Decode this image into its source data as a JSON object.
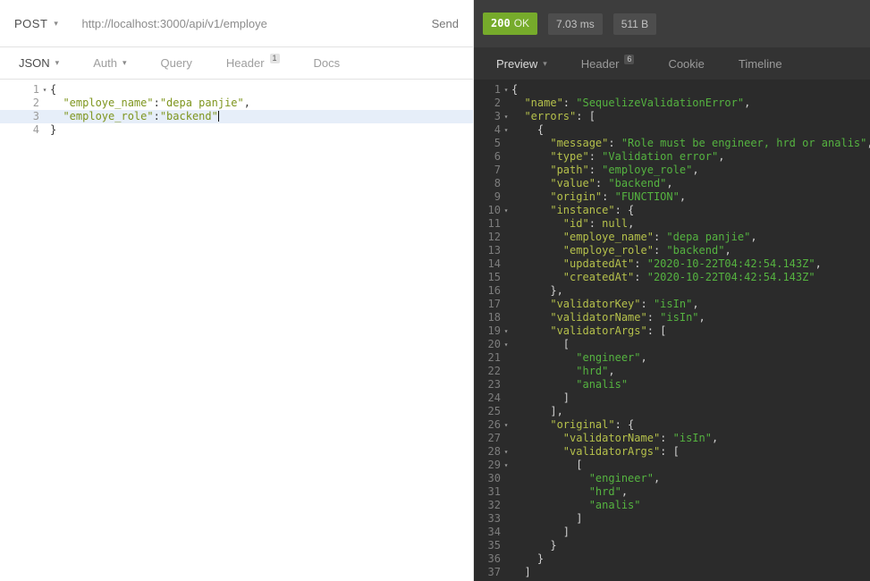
{
  "icons": {
    "chevron_down": "▾",
    "fold": "▾"
  },
  "request_bar": {
    "method": "POST",
    "url": "http://localhost:3000/api/v1/employe",
    "send_label": "Send"
  },
  "response_meta": {
    "status_code": "200",
    "status_text": "OK",
    "time": "7.03 ms",
    "size": "511 B"
  },
  "request_tabs": [
    {
      "label": "JSON",
      "active": true,
      "dropdown": true
    },
    {
      "label": "Auth",
      "dropdown": true
    },
    {
      "label": "Query"
    },
    {
      "label": "Header",
      "badge": "1"
    },
    {
      "label": "Docs"
    }
  ],
  "response_tabs": [
    {
      "label": "Preview",
      "active": true,
      "dropdown": true
    },
    {
      "label": "Header",
      "badge": "6"
    },
    {
      "label": "Cookie"
    },
    {
      "label": "Timeline"
    }
  ],
  "request_editor": {
    "lines": [
      {
        "n": 1,
        "f": true,
        "t": [
          [
            "p",
            "{"
          ]
        ]
      },
      {
        "n": 2,
        "f": false,
        "t": [
          [
            "k",
            "  \"employe_name\""
          ],
          [
            "p",
            ":"
          ],
          [
            "s",
            "\"depa panjie\""
          ],
          [
            "p",
            ","
          ]
        ]
      },
      {
        "n": 3,
        "f": false,
        "a": true,
        "t": [
          [
            "k",
            "  \"employe_role\""
          ],
          [
            "p",
            ":"
          ],
          [
            "s",
            "\"backend\""
          ],
          [
            "cur",
            ""
          ]
        ]
      },
      {
        "n": 4,
        "f": false,
        "t": [
          [
            "p",
            "}"
          ]
        ]
      }
    ]
  },
  "response_viewer": {
    "lines": [
      {
        "n": 1,
        "f": true,
        "t": [
          [
            "p",
            "{"
          ]
        ]
      },
      {
        "n": 2,
        "f": false,
        "t": [
          [
            "k",
            "  \"name\""
          ],
          [
            "p",
            ": "
          ],
          [
            "s",
            "\"SequelizeValidationError\""
          ],
          [
            "p",
            ","
          ]
        ]
      },
      {
        "n": 3,
        "f": true,
        "t": [
          [
            "k",
            "  \"errors\""
          ],
          [
            "p",
            ": ["
          ]
        ]
      },
      {
        "n": 4,
        "f": true,
        "t": [
          [
            "p",
            "    {"
          ]
        ]
      },
      {
        "n": 5,
        "f": false,
        "t": [
          [
            "k",
            "      \"message\""
          ],
          [
            "p",
            ": "
          ],
          [
            "s",
            "\"Role must be engineer, hrd or analis\""
          ],
          [
            "p",
            ","
          ]
        ]
      },
      {
        "n": 6,
        "f": false,
        "t": [
          [
            "k",
            "      \"type\""
          ],
          [
            "p",
            ": "
          ],
          [
            "s",
            "\"Validation error\""
          ],
          [
            "p",
            ","
          ]
        ]
      },
      {
        "n": 7,
        "f": false,
        "t": [
          [
            "k",
            "      \"path\""
          ],
          [
            "p",
            ": "
          ],
          [
            "s",
            "\"employe_role\""
          ],
          [
            "p",
            ","
          ]
        ]
      },
      {
        "n": 8,
        "f": false,
        "t": [
          [
            "k",
            "      \"value\""
          ],
          [
            "p",
            ": "
          ],
          [
            "s",
            "\"backend\""
          ],
          [
            "p",
            ","
          ]
        ]
      },
      {
        "n": 9,
        "f": false,
        "t": [
          [
            "k",
            "      \"origin\""
          ],
          [
            "p",
            ": "
          ],
          [
            "s",
            "\"FUNCTION\""
          ],
          [
            "p",
            ","
          ]
        ]
      },
      {
        "n": 10,
        "f": true,
        "t": [
          [
            "k",
            "      \"instance\""
          ],
          [
            "p",
            ": {"
          ]
        ]
      },
      {
        "n": 11,
        "f": false,
        "t": [
          [
            "k",
            "        \"id\""
          ],
          [
            "p",
            ": "
          ],
          [
            "n",
            "null"
          ],
          [
            "p",
            ","
          ]
        ]
      },
      {
        "n": 12,
        "f": false,
        "t": [
          [
            "k",
            "        \"employe_name\""
          ],
          [
            "p",
            ": "
          ],
          [
            "s",
            "\"depa panjie\""
          ],
          [
            "p",
            ","
          ]
        ]
      },
      {
        "n": 13,
        "f": false,
        "t": [
          [
            "k",
            "        \"employe_role\""
          ],
          [
            "p",
            ": "
          ],
          [
            "s",
            "\"backend\""
          ],
          [
            "p",
            ","
          ]
        ]
      },
      {
        "n": 14,
        "f": false,
        "t": [
          [
            "k",
            "        \"updatedAt\""
          ],
          [
            "p",
            ": "
          ],
          [
            "s",
            "\"2020-10-22T04:42:54.143Z\""
          ],
          [
            "p",
            ","
          ]
        ]
      },
      {
        "n": 15,
        "f": false,
        "t": [
          [
            "k",
            "        \"createdAt\""
          ],
          [
            "p",
            ": "
          ],
          [
            "s",
            "\"2020-10-22T04:42:54.143Z\""
          ]
        ]
      },
      {
        "n": 16,
        "f": false,
        "t": [
          [
            "p",
            "      },"
          ]
        ]
      },
      {
        "n": 17,
        "f": false,
        "t": [
          [
            "k",
            "      \"validatorKey\""
          ],
          [
            "p",
            ": "
          ],
          [
            "s",
            "\"isIn\""
          ],
          [
            "p",
            ","
          ]
        ]
      },
      {
        "n": 18,
        "f": false,
        "t": [
          [
            "k",
            "      \"validatorName\""
          ],
          [
            "p",
            ": "
          ],
          [
            "s",
            "\"isIn\""
          ],
          [
            "p",
            ","
          ]
        ]
      },
      {
        "n": 19,
        "f": true,
        "t": [
          [
            "k",
            "      \"validatorArgs\""
          ],
          [
            "p",
            ": ["
          ]
        ]
      },
      {
        "n": 20,
        "f": true,
        "t": [
          [
            "p",
            "        ["
          ]
        ]
      },
      {
        "n": 21,
        "f": false,
        "t": [
          [
            "s",
            "          \"engineer\""
          ],
          [
            "p",
            ","
          ]
        ]
      },
      {
        "n": 22,
        "f": false,
        "t": [
          [
            "s",
            "          \"hrd\""
          ],
          [
            "p",
            ","
          ]
        ]
      },
      {
        "n": 23,
        "f": false,
        "t": [
          [
            "s",
            "          \"analis\""
          ]
        ]
      },
      {
        "n": 24,
        "f": false,
        "t": [
          [
            "p",
            "        ]"
          ]
        ]
      },
      {
        "n": 25,
        "f": false,
        "t": [
          [
            "p",
            "      ],"
          ]
        ]
      },
      {
        "n": 26,
        "f": true,
        "t": [
          [
            "k",
            "      \"original\""
          ],
          [
            "p",
            ": {"
          ]
        ]
      },
      {
        "n": 27,
        "f": false,
        "t": [
          [
            "k",
            "        \"validatorName\""
          ],
          [
            "p",
            ": "
          ],
          [
            "s",
            "\"isIn\""
          ],
          [
            "p",
            ","
          ]
        ]
      },
      {
        "n": 28,
        "f": true,
        "t": [
          [
            "k",
            "        \"validatorArgs\""
          ],
          [
            "p",
            ": ["
          ]
        ]
      },
      {
        "n": 29,
        "f": true,
        "t": [
          [
            "p",
            "          ["
          ]
        ]
      },
      {
        "n": 30,
        "f": false,
        "t": [
          [
            "s",
            "            \"engineer\""
          ],
          [
            "p",
            ","
          ]
        ]
      },
      {
        "n": 31,
        "f": false,
        "t": [
          [
            "s",
            "            \"hrd\""
          ],
          [
            "p",
            ","
          ]
        ]
      },
      {
        "n": 32,
        "f": false,
        "t": [
          [
            "s",
            "            \"analis\""
          ]
        ]
      },
      {
        "n": 33,
        "f": false,
        "t": [
          [
            "p",
            "          ]"
          ]
        ]
      },
      {
        "n": 34,
        "f": false,
        "t": [
          [
            "p",
            "        ]"
          ]
        ]
      },
      {
        "n": 35,
        "f": false,
        "t": [
          [
            "p",
            "      }"
          ]
        ]
      },
      {
        "n": 36,
        "f": false,
        "t": [
          [
            "p",
            "    }"
          ]
        ]
      },
      {
        "n": 37,
        "f": false,
        "t": [
          [
            "p",
            "  ]"
          ]
        ]
      }
    ]
  }
}
